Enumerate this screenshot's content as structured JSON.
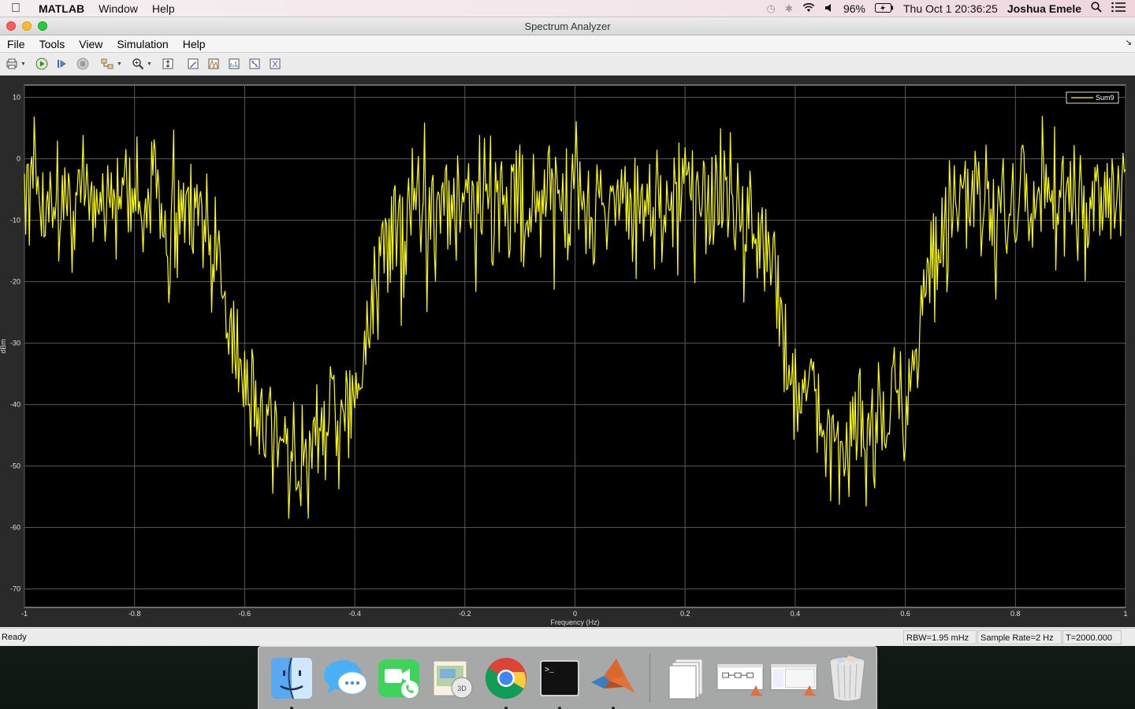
{
  "menubar": {
    "app_name": "MATLAB",
    "items": [
      "Window",
      "Help"
    ],
    "battery": "96%",
    "datetime": "Thu Oct 1  20:36:25",
    "user": "Joshua Emele"
  },
  "window": {
    "title": "Spectrum Analyzer",
    "menu": [
      "File",
      "Tools",
      "View",
      "Simulation",
      "Help"
    ]
  },
  "toolbar": {
    "icons": [
      "print-icon",
      "run-icon",
      "step-forward-icon",
      "stop-icon",
      "highlight-icon",
      "zoom-in-icon",
      "scale-axes-icon",
      "settings-icon",
      "peak-finder-icon",
      "distortion-icon",
      "cursor-icon",
      "channel-measure-icon"
    ]
  },
  "chart_data": {
    "type": "line",
    "title": "",
    "xlabel": "Frequency (Hz)",
    "ylabel": "dBm",
    "xlim": [
      -1,
      1
    ],
    "ylim": [
      -73,
      12
    ],
    "x_ticks": [
      -1,
      -0.8,
      -0.6,
      -0.4,
      -0.2,
      0,
      0.2,
      0.4,
      0.6,
      0.8,
      1
    ],
    "y_ticks": [
      10,
      0,
      -10,
      -20,
      -30,
      -40,
      -50,
      -60,
      -70
    ],
    "grid": true,
    "legend_position": "top-right",
    "series": [
      {
        "name": "Sum9",
        "color": "#ffff00",
        "envelope_x": [
          -1,
          -0.72,
          -0.68,
          -0.64,
          -0.6,
          -0.5,
          -0.4,
          -0.36,
          -0.32,
          -0.28,
          0.28,
          0.32,
          0.36,
          0.4,
          0.5,
          0.6,
          0.64,
          0.68,
          0.72,
          1
        ],
        "envelope_y": [
          -6,
          -6,
          -10,
          -18,
          -38,
          -47,
          -38,
          -18,
          -10,
          -6,
          -6,
          -10,
          -18,
          -38,
          -47,
          -38,
          -18,
          -10,
          -6,
          -6
        ],
        "points": 900,
        "noise_db": 7
      }
    ]
  },
  "status": {
    "ready": "Ready",
    "rbw": "RBW=1.95 mHz",
    "sample_rate": "Sample Rate=2 Hz",
    "time": "T=2000.000"
  },
  "dock": {
    "items": [
      "finder-icon",
      "messages-icon",
      "facetime-icon",
      "preview-icon",
      "chrome-icon",
      "terminal-icon",
      "matlab-icon",
      "documents-icon",
      "simulink-window-icon",
      "matlab-window-icon",
      "trash-icon"
    ]
  }
}
